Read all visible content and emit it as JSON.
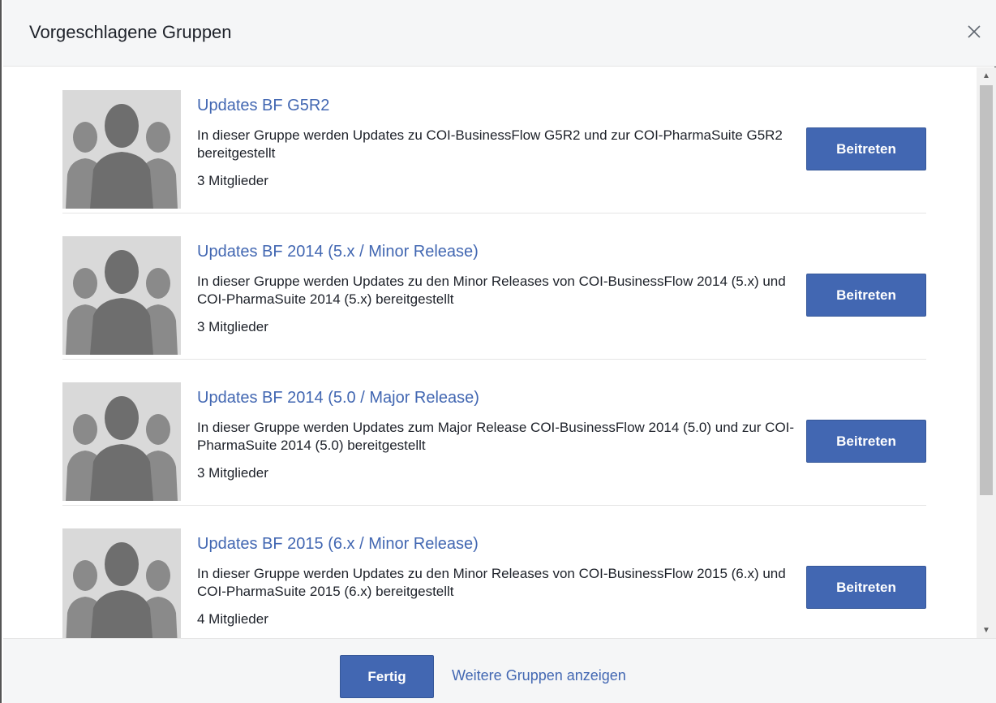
{
  "dialog": {
    "title": "Vorgeschlagene Gruppen",
    "close_icon": "close-icon"
  },
  "groups": [
    {
      "name": "Updates BF G5R2",
      "description": "In dieser Gruppe werden Updates zu COI-BusinessFlow G5R2 und zur COI-PharmaSuite G5R2 bereitgestellt",
      "members": "3 Mitglieder",
      "join_label": "Beitreten"
    },
    {
      "name": "Updates BF 2014 (5.x / Minor Release)",
      "description": "In dieser Gruppe werden Updates zu den Minor Releases von COI-BusinessFlow 2014 (5.x) und COI-PharmaSuite 2014 (5.x) bereitgestellt",
      "members": "3 Mitglieder",
      "join_label": "Beitreten"
    },
    {
      "name": "Updates BF 2014 (5.0 / Major Release)",
      "description": "In dieser Gruppe werden Updates zum Major Release COI-BusinessFlow 2014 (5.0) und zur COI-PharmaSuite 2014 (5.0) bereitgestellt",
      "members": "3 Mitglieder",
      "join_label": "Beitreten"
    },
    {
      "name": "Updates BF 2015 (6.x / Minor Release)",
      "description": "In dieser Gruppe werden Updates zu den Minor Releases von COI-BusinessFlow 2015 (6.x) und COI-PharmaSuite 2015 (6.x) bereitgestellt",
      "members": "4 Mitglieder",
      "join_label": "Beitreten"
    }
  ],
  "footer": {
    "done_label": "Fertig",
    "more_label": "Weitere Gruppen anzeigen"
  },
  "colors": {
    "accent": "#4267b2",
    "header_bg": "#f5f6f7",
    "text": "#1d2129"
  }
}
